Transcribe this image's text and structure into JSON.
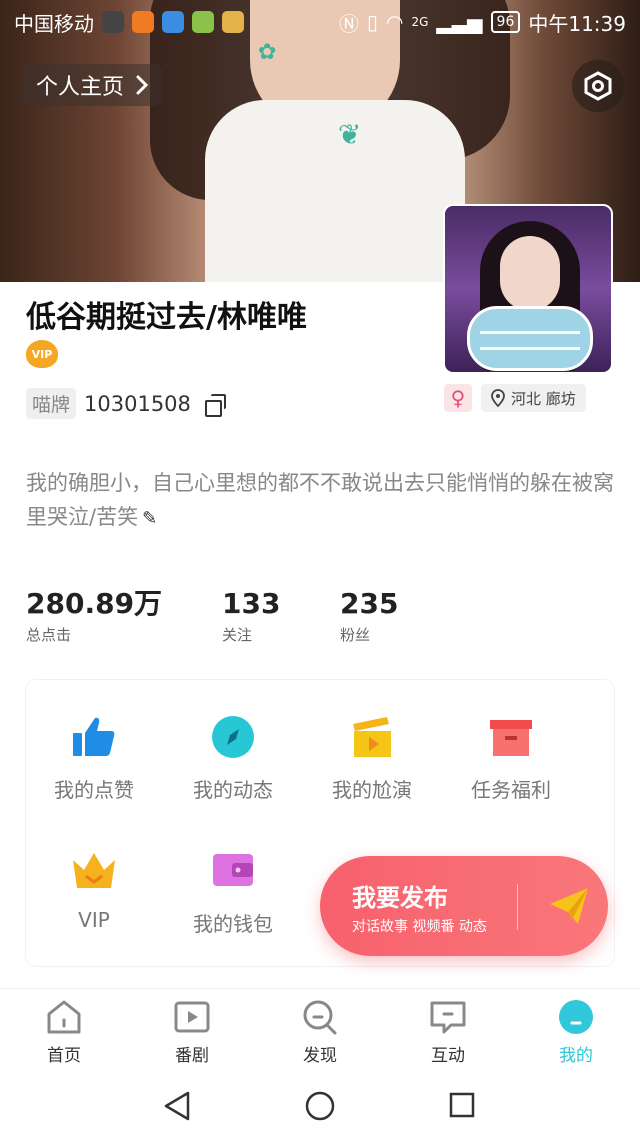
{
  "status_bar": {
    "carrier": "中国移动",
    "network": "2G",
    "battery": "96",
    "time": "中午11:39"
  },
  "header": {
    "profile_link": "个人主页"
  },
  "profile": {
    "name": "低谷期挺过去/林唯唯",
    "vip_label": "VIP",
    "id_tag": "喵牌",
    "id_value": "10301508",
    "gender_symbol": "♀",
    "location": "河北 廊坊",
    "bio": "我的确胆小，自己心里想的都不不敢说出去只能悄悄的躲在被窝里哭泣/苦笑"
  },
  "stats": [
    {
      "value": "280.89万",
      "label": "总点击"
    },
    {
      "value": "133",
      "label": "关注"
    },
    {
      "value": "235",
      "label": "粉丝"
    }
  ],
  "grid": [
    {
      "label": "我的点赞",
      "icon": "thumbs-up-icon"
    },
    {
      "label": "我的动态",
      "icon": "compass-icon"
    },
    {
      "label": "我的尬演",
      "icon": "clapperboard-icon"
    },
    {
      "label": "任务福利",
      "icon": "gift-box-icon"
    },
    {
      "label": "VIP",
      "icon": "crown-icon"
    },
    {
      "label": "我的钱包",
      "icon": "wallet-icon"
    }
  ],
  "publish": {
    "title": "我要发布",
    "subtitle": "对话故事 视频番 动态"
  },
  "tabs": [
    {
      "label": "首页",
      "icon": "home-icon"
    },
    {
      "label": "番剧",
      "icon": "play-icon"
    },
    {
      "label": "发现",
      "icon": "search-icon"
    },
    {
      "label": "互动",
      "icon": "chat-icon"
    },
    {
      "label": "我的",
      "icon": "profile-icon",
      "active": true
    }
  ],
  "colors": {
    "accent": "#2fc7d9",
    "publish": "#f7616d",
    "vip": "#f5a623"
  }
}
